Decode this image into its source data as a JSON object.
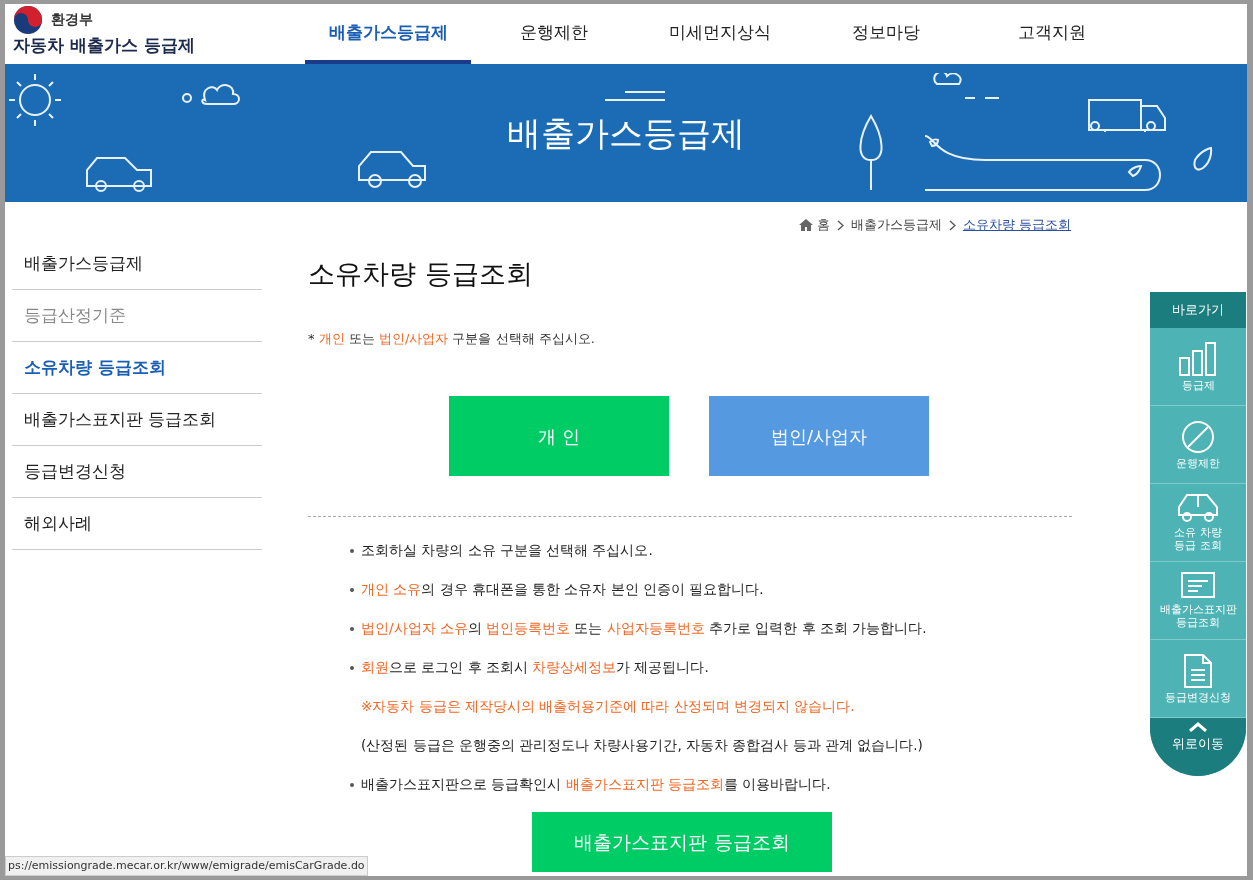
{
  "header": {
    "ministry": "환경부",
    "site_title": "자동차 배출가스 등급제"
  },
  "nav": [
    {
      "label": "배출가스등급제",
      "selected": true
    },
    {
      "label": "운행제한",
      "selected": false
    },
    {
      "label": "미세먼지상식",
      "selected": false
    },
    {
      "label": "정보마당",
      "selected": false
    },
    {
      "label": "고객지원",
      "selected": false
    }
  ],
  "banner": {
    "title": "배출가스등급제"
  },
  "breadcrumb": [
    "홈",
    "배출가스등급제",
    "소유차량 등급조회"
  ],
  "sidebar": [
    {
      "label": "배출가스등급제",
      "selected": false,
      "disabled": false
    },
    {
      "label": "등급산정기준",
      "selected": false,
      "disabled": true
    },
    {
      "label": "소유차량 등급조회",
      "selected": true,
      "disabled": false
    },
    {
      "label": "배출가스표지판 등급조회",
      "selected": false,
      "disabled": false
    },
    {
      "label": "등급변경신청",
      "selected": false,
      "disabled": false
    },
    {
      "label": "해외사례",
      "selected": false,
      "disabled": false
    }
  ],
  "page_title": "소유차량 등급조회",
  "instruction": [
    {
      "text": "* ",
      "hl": false
    },
    {
      "text": "개인",
      "hl": true
    },
    {
      "text": " 또는 ",
      "hl": false
    },
    {
      "text": "법인/사업자",
      "hl": true
    },
    {
      "text": " 구분을 선택해 주십시오.",
      "hl": false
    }
  ],
  "choice_buttons": [
    {
      "label": "개 인",
      "color": "#00cc66"
    },
    {
      "label": "법인/사업자",
      "color": "#5599e0"
    }
  ],
  "notes": [
    {
      "kind": "bullet",
      "parts": [
        {
          "text": "조회하실 차량의 소유 구분을 선택해 주십시오.",
          "hl": false
        }
      ]
    },
    {
      "kind": "bullet",
      "parts": [
        {
          "text": "개인 소유",
          "hl": true
        },
        {
          "text": "의 경우 휴대폰을 통한 소유자 본인 인증이 필요합니다.",
          "hl": false
        }
      ]
    },
    {
      "kind": "bullet",
      "parts": [
        {
          "text": "법인/사업자 소유",
          "hl": true
        },
        {
          "text": "의 ",
          "hl": false
        },
        {
          "text": "법인등록번호",
          "hl": true
        },
        {
          "text": " 또는 ",
          "hl": false
        },
        {
          "text": "사업자등록번호",
          "hl": true
        },
        {
          "text": " 추가로 입력한 후 조회 가능합니다.",
          "hl": false
        }
      ]
    },
    {
      "kind": "bullet",
      "parts": [
        {
          "text": "회원",
          "hl": true
        },
        {
          "text": "으로 로그인 후 조회시 ",
          "hl": false
        },
        {
          "text": "차량상세정보",
          "hl": true
        },
        {
          "text": "가 제공됩니다.",
          "hl": false
        }
      ]
    },
    {
      "kind": "sub",
      "parts": [
        {
          "text": "※자동차 등급은 제작당시의 배출허용기준에 따라 산정되며 변경되지 않습니다.",
          "hl": true
        }
      ]
    },
    {
      "kind": "sub",
      "parts": [
        {
          "text": "(산정된 등급은 운행중의 관리정도나 차량사용기간, 자동차 종합검사 등과 관계 없습니다.)",
          "hl": false
        }
      ]
    },
    {
      "kind": "bullet",
      "parts": [
        {
          "text": "배출가스표지판으로 등급확인시 ",
          "hl": false
        },
        {
          "text": "배출가스표지판 등급조회",
          "hl": true
        },
        {
          "text": "를 이용바랍니다.",
          "hl": false
        }
      ]
    }
  ],
  "sign_lookup_button": "배출가스표지판 등급조회",
  "quick_menu": {
    "title": "바로가기",
    "items": [
      {
        "kind": "chart",
        "label": "등급제"
      },
      {
        "kind": "ban",
        "label": "운행제한"
      },
      {
        "kind": "car",
        "label": "소유 차량\n등급 조회"
      },
      {
        "kind": "sign",
        "label": "배출가스표지판\n등급조회"
      },
      {
        "kind": "doc",
        "label": "등급변경신청"
      }
    ],
    "top_button": "위로이동"
  },
  "status_url": "ps://emissiongrade.mecar.or.kr/www/emigrade/emisCarGrade.do"
}
